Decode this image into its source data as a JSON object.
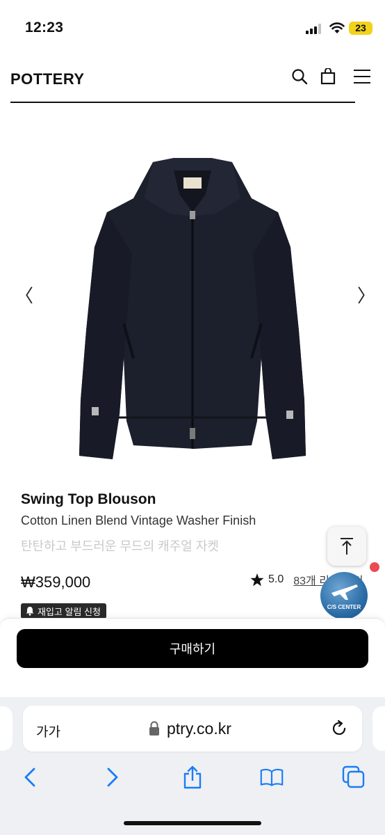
{
  "status_bar": {
    "time": "12:23",
    "battery": "23"
  },
  "header": {
    "brand": "POTTERY"
  },
  "product": {
    "name": "Swing Top Blouson",
    "subtitle": "Cotton Linen Blend Vintage Washer Finish",
    "description": "탄탄하고 부드러운 무드의 캐주얼 자켓",
    "price": "₩359,000",
    "rating": "5.0",
    "review_link": "83개 리뷰 보기",
    "restock_label": "재입고 알림 신청"
  },
  "cs_badge": {
    "label": "C/S CENTER"
  },
  "buy": {
    "label": "구매하기"
  },
  "browser": {
    "text_size": "가가",
    "url": "ptry.co.kr"
  },
  "colors": {
    "accent": "#000000",
    "dot": "#ea4b52",
    "ios_blue": "#1a7cf5"
  }
}
